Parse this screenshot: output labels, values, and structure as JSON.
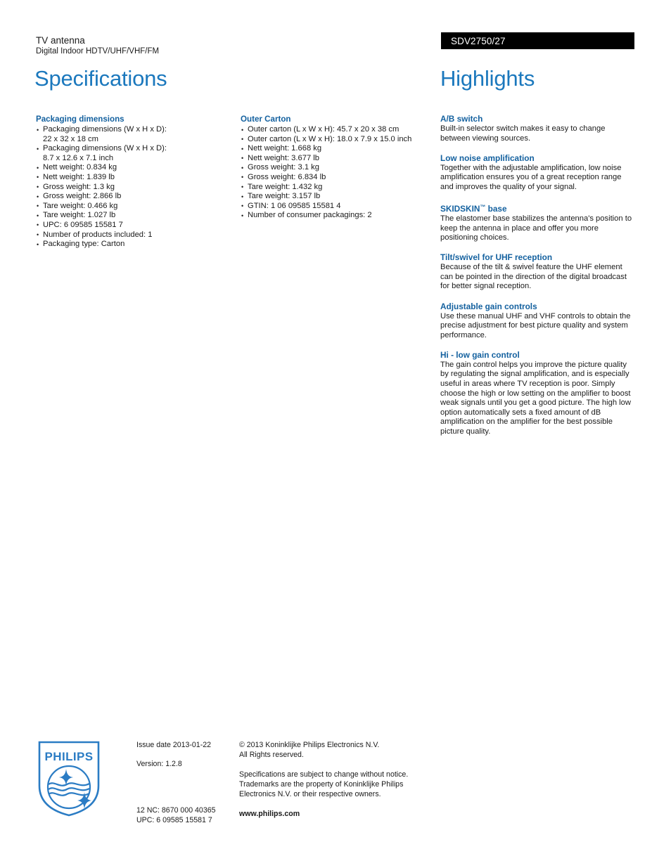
{
  "header": {
    "product_type": "TV antenna",
    "product_desc": "Digital Indoor HDTV/UHF/VHF/FM",
    "model_number": "SDV2750/27"
  },
  "titles": {
    "specifications": "Specifications",
    "highlights": "Highlights"
  },
  "colors": {
    "title_blue": "#1b78bd",
    "heading_blue": "#14619f",
    "bar_black": "#000000"
  },
  "specs": {
    "packaging": {
      "heading": "Packaging dimensions",
      "items": [
        {
          "text": "Packaging dimensions (W x H x D):",
          "cont": "22 x 32 x 18 cm"
        },
        {
          "text": "Packaging dimensions (W x H x D):",
          "cont": "8.7 x 12.6 x 7.1 inch"
        },
        {
          "text": "Nett weight: 0.834 kg"
        },
        {
          "text": "Nett weight: 1.839 lb"
        },
        {
          "text": "Gross weight: 1.3 kg"
        },
        {
          "text": "Gross weight: 2.866 lb"
        },
        {
          "text": "Tare weight: 0.466 kg"
        },
        {
          "text": "Tare weight: 1.027 lb"
        },
        {
          "text": "UPC: 6 09585 15581 7"
        },
        {
          "text": "Number of products included: 1"
        },
        {
          "text": "Packaging type: Carton"
        }
      ]
    },
    "outer_carton": {
      "heading": "Outer Carton",
      "items": [
        {
          "text": "Outer carton (L x W x H): 45.7 x 20 x 38 cm"
        },
        {
          "text": "Outer carton (L x W x H): 18.0 x 7.9 x 15.0 inch"
        },
        {
          "text": "Nett weight: 1.668 kg"
        },
        {
          "text": "Nett weight: 3.677 lb"
        },
        {
          "text": "Gross weight: 3.1 kg"
        },
        {
          "text": "Gross weight: 6.834 lb"
        },
        {
          "text": "Tare weight: 1.432 kg"
        },
        {
          "text": "Tare weight: 3.157 lb"
        },
        {
          "text": "GTIN: 1 06 09585 15581 4"
        },
        {
          "text": "Number of consumer packagings: 2"
        }
      ]
    }
  },
  "highlights": [
    {
      "title": "A/B switch",
      "body": "Built-in selector switch makes it easy to change between viewing sources."
    },
    {
      "title": "Low noise amplification",
      "body": "Together with the adjustable amplification, low noise amplification ensures you of a great reception range and improves the quality of your signal."
    },
    {
      "title": "SKIDSKIN",
      "title_tm": "™",
      "title_tail": " base",
      "body": "The elastomer base stabilizes the antenna's position to keep the antenna in place and offer you more positioning choices."
    },
    {
      "title": "Tilt/swivel for UHF reception",
      "body": "Because of the tilt & swivel feature the UHF element can be pointed in the direction of the digital broadcast for better signal reception."
    },
    {
      "title": "Adjustable gain controls",
      "body": "Use these manual UHF and VHF controls to obtain the precise adjustment for best picture quality and system performance."
    },
    {
      "title": "Hi - low gain control",
      "body": "The gain control helps you improve the picture quality by regulating the signal amplification, and is especially useful in areas where TV reception is poor. Simply choose the high or low setting on the amplifier to boost weak signals until you get a good picture. The high low option automatically sets a fixed amount of dB amplification on the amplifier for the best possible picture quality."
    }
  ],
  "footer": {
    "logo_word": "PHILIPS",
    "issue_date": "Issue date 2013-01-22",
    "version": "Version: 1.2.8",
    "nc_code": "12 NC: 8670 000 40365",
    "upc": "UPC: 6 09585 15581 7",
    "copyright_line1": "© 2013 Koninklijke Philips Electronics N.V.",
    "copyright_line2": "All Rights reserved.",
    "disclaimer_line1": "Specifications are subject to change without notice.",
    "disclaimer_line2": "Trademarks are the property of Koninklijke Philips",
    "disclaimer_line3": "Electronics N.V. or their respective owners.",
    "website": "www.philips.com"
  }
}
